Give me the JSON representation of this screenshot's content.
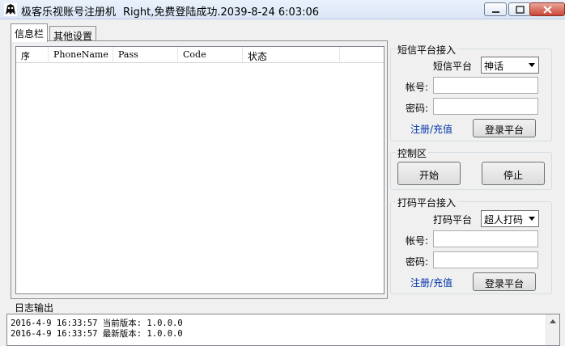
{
  "window": {
    "title": "极客乐视账号注册机",
    "status": "Right,免费登陆成功.2039-8-24 6:03:06"
  },
  "tabs": [
    {
      "label": "信息栏",
      "active": true
    },
    {
      "label": "其他设置",
      "active": false
    }
  ],
  "table": {
    "columns": [
      "序",
      "PhoneName",
      "Pass",
      "Code",
      "状态"
    ],
    "rows": []
  },
  "sms_platform": {
    "title": "短信平台接入",
    "platform_label": "短信平台",
    "platform_value": "神话",
    "account_label": "帐号:",
    "account_value": "",
    "password_label": "密码:",
    "password_value": "",
    "register_link": "注册/充值",
    "login_button": "登录平台"
  },
  "control": {
    "title": "控制区",
    "start_button": "开始",
    "stop_button": "停止"
  },
  "captcha_platform": {
    "title": "打码平台接入",
    "platform_label": "打码平台",
    "platform_value": "超人打码",
    "account_label": "帐号:",
    "account_value": "",
    "password_label": "密码:",
    "password_value": "",
    "register_link": "注册/充值",
    "login_button": "登录平台"
  },
  "log": {
    "title": "日志输出",
    "lines": [
      "2016-4-9 16:33:57 当前版本: 1.0.0.0",
      "2016-4-9 16:33:57 最新版本: 1.0.0.0"
    ]
  }
}
